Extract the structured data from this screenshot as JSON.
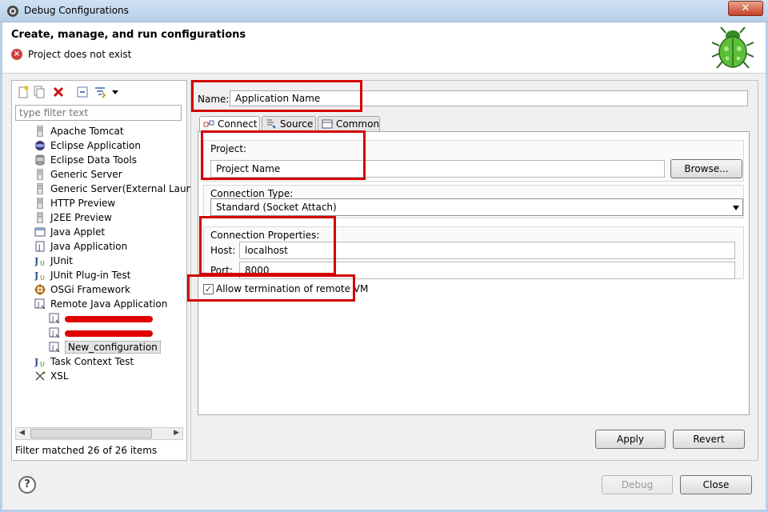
{
  "window": {
    "title": "Debug Configurations",
    "close_glyph": "✕"
  },
  "header": {
    "title": "Create, manage, and run configurations",
    "message": "Project does not exist",
    "message_icon": "error-icon",
    "logo": "debug-bug-icon"
  },
  "left": {
    "toolbar": [
      "new-launch-configuration-icon",
      "duplicate-icon",
      "delete-icon",
      "collapse-all-icon",
      "filter-icon",
      "view-menu-chevron-icon"
    ],
    "filter_placeholder": "type filter text",
    "tree": [
      {
        "label": "Apache Tomcat",
        "icon": "server-icon",
        "level": 1
      },
      {
        "label": "Eclipse Application",
        "icon": "eclipse-icon",
        "level": 1
      },
      {
        "label": "Eclipse Data Tools",
        "icon": "database-icon",
        "level": 1
      },
      {
        "label": "Generic Server",
        "icon": "server-icon",
        "level": 1
      },
      {
        "label": "Generic Server(External Launch)",
        "icon": "server-icon",
        "level": 1
      },
      {
        "label": "HTTP Preview",
        "icon": "server-icon",
        "level": 1
      },
      {
        "label": "J2EE Preview",
        "icon": "server-icon",
        "level": 1
      },
      {
        "label": "Java Applet",
        "icon": "applet-icon",
        "level": 1
      },
      {
        "label": "Java Application",
        "icon": "java-app-icon",
        "level": 1
      },
      {
        "label": "JUnit",
        "icon": "junit-icon",
        "level": 1
      },
      {
        "label": "JUnit Plug-in Test",
        "icon": "junit-plugin-icon",
        "level": 1
      },
      {
        "label": "OSGi Framework",
        "icon": "osgi-icon",
        "level": 1
      },
      {
        "label": "Remote Java Application",
        "icon": "remote-java-icon",
        "level": 1
      },
      {
        "label": "",
        "icon": "remote-java-icon",
        "level": 2,
        "redacted": true
      },
      {
        "label": "",
        "icon": "remote-java-icon",
        "level": 2,
        "redacted": true
      },
      {
        "label": "New_configuration",
        "icon": "remote-java-icon",
        "level": 2,
        "selected": true
      },
      {
        "label": "Task Context Test",
        "icon": "junit-icon",
        "level": 1
      },
      {
        "label": "XSL",
        "icon": "xsl-icon",
        "level": 1
      }
    ],
    "filter_status": "Filter matched 26 of 26 items"
  },
  "right": {
    "name_label": "Name:",
    "name_value": "Application Name",
    "tabs": [
      {
        "label": "Connect",
        "icon": "connect-icon",
        "active": true
      },
      {
        "label": "Source",
        "icon": "source-icon",
        "active": false
      },
      {
        "label": "Common",
        "icon": "common-icon",
        "active": false
      }
    ],
    "project": {
      "label": "Project:",
      "value": "Project Name",
      "browse": "Browse..."
    },
    "connection_type": {
      "label": "Connection Type:",
      "value": "Standard (Socket Attach)"
    },
    "connection_properties": {
      "label": "Connection Properties:",
      "host_label": "Host:",
      "host_value": "localhost",
      "port_label": "Port:",
      "port_value": "8000"
    },
    "allow_termination": {
      "label": "Allow termination of remote VM",
      "checked": true,
      "mark": "✓"
    },
    "apply": "Apply",
    "revert": "Revert"
  },
  "footer": {
    "help_glyph": "?",
    "debug": "Debug",
    "close": "Close"
  },
  "colors": {
    "annotation": "#d40000",
    "titlebar": "#b8cfe9"
  }
}
